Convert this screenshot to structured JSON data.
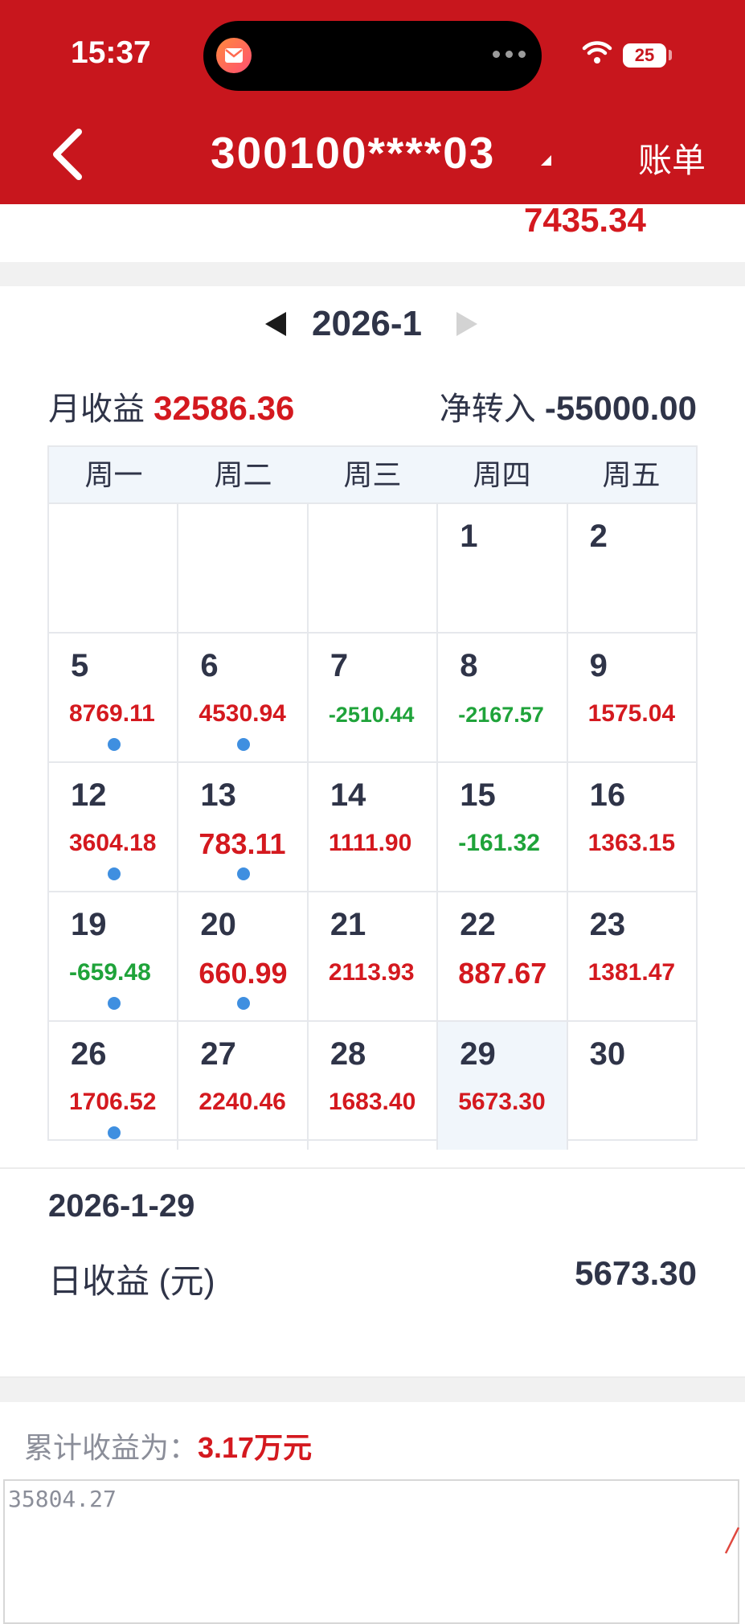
{
  "status_bar": {
    "time": "15:37",
    "battery": "25"
  },
  "header": {
    "account": "300100****03",
    "bill_label": "账单"
  },
  "top_card": {
    "value": "7435.34"
  },
  "month_nav": {
    "month": "2026-1"
  },
  "summary": {
    "monthly_label": "月收益",
    "monthly_value": "32586.36",
    "net_label": "净转入",
    "net_value": "-55000.00"
  },
  "calendar": {
    "weekdays": [
      "周一",
      "周二",
      "周三",
      "周四",
      "周五"
    ],
    "weeks": [
      [
        {
          "day": "",
          "amount": "",
          "sign": "",
          "dot": false
        },
        {
          "day": "",
          "amount": "",
          "sign": "",
          "dot": false
        },
        {
          "day": "",
          "amount": "",
          "sign": "",
          "dot": false
        },
        {
          "day": "1",
          "amount": "",
          "sign": "",
          "dot": false
        },
        {
          "day": "2",
          "amount": "",
          "sign": "",
          "dot": false
        }
      ],
      [
        {
          "day": "5",
          "amount": "8769.11",
          "sign": "pos",
          "dot": true
        },
        {
          "day": "6",
          "amount": "4530.94",
          "sign": "pos",
          "dot": true
        },
        {
          "day": "7",
          "amount": "-2510.44",
          "sign": "neg",
          "dot": false
        },
        {
          "day": "8",
          "amount": "-2167.57",
          "sign": "neg",
          "dot": false
        },
        {
          "day": "9",
          "amount": "1575.04",
          "sign": "pos",
          "dot": false
        }
      ],
      [
        {
          "day": "12",
          "amount": "3604.18",
          "sign": "pos",
          "dot": true
        },
        {
          "day": "13",
          "amount": "783.11",
          "sign": "pos",
          "dot": true
        },
        {
          "day": "14",
          "amount": "1111.90",
          "sign": "pos",
          "dot": false
        },
        {
          "day": "15",
          "amount": "-161.32",
          "sign": "neg",
          "dot": false
        },
        {
          "day": "16",
          "amount": "1363.15",
          "sign": "pos",
          "dot": false
        }
      ],
      [
        {
          "day": "19",
          "amount": "-659.48",
          "sign": "neg",
          "dot": true
        },
        {
          "day": "20",
          "amount": "660.99",
          "sign": "pos",
          "dot": true
        },
        {
          "day": "21",
          "amount": "2113.93",
          "sign": "pos",
          "dot": false
        },
        {
          "day": "22",
          "amount": "887.67",
          "sign": "pos",
          "dot": false
        },
        {
          "day": "23",
          "amount": "1381.47",
          "sign": "pos",
          "dot": false
        }
      ],
      [
        {
          "day": "26",
          "amount": "1706.52",
          "sign": "pos",
          "dot": true
        },
        {
          "day": "27",
          "amount": "2240.46",
          "sign": "pos",
          "dot": false
        },
        {
          "day": "28",
          "amount": "1683.40",
          "sign": "pos",
          "dot": false
        },
        {
          "day": "29",
          "amount": "5673.30",
          "sign": "pos",
          "dot": false,
          "selected": true
        },
        {
          "day": "30",
          "amount": "",
          "sign": "",
          "dot": false
        }
      ]
    ]
  },
  "selected_day": {
    "date": "2026-1-29",
    "label": "日收益 (元)",
    "value": "5673.30"
  },
  "cumulative": {
    "label": "累计收益为：",
    "value": "3.17万元",
    "chart_peak": "35804.27"
  },
  "colors": {
    "brand_red": "#c8161d",
    "gain": "#d4191f",
    "loss": "#1fa33a",
    "dot": "#3f8fe0"
  }
}
